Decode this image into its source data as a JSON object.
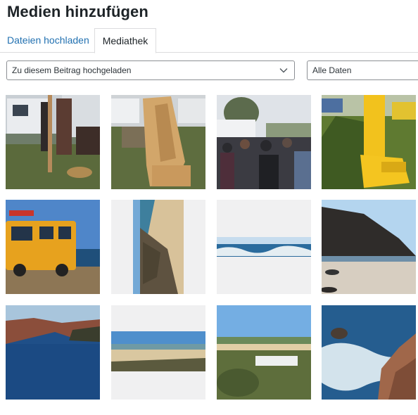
{
  "header": {
    "title": "Medien hinzufügen"
  },
  "tabs": [
    {
      "label": "Dateien hochladen"
    },
    {
      "label": "Mediathek"
    }
  ],
  "filters": {
    "attachment_filter": "Zu diesem Beitrag hochgeladen",
    "date_filter": "Alle Daten"
  },
  "colors": {
    "link": "#2271b1",
    "border": "#dcdcde"
  },
  "media": [
    {
      "type": "image",
      "subject": "camper-vans-people"
    },
    {
      "type": "image",
      "subject": "wooden-sculpture"
    },
    {
      "type": "image",
      "subject": "market-crowd"
    },
    {
      "type": "image",
      "subject": "yellow-excavator"
    },
    {
      "type": "image",
      "subject": "yellow-van-coast"
    },
    {
      "type": "image",
      "subject": "beach-cliff-vertical"
    },
    {
      "type": "image",
      "subject": "ocean-panorama"
    },
    {
      "type": "image",
      "subject": "beach-cliffs"
    },
    {
      "type": "image",
      "subject": "sea-cliffs"
    },
    {
      "type": "image",
      "subject": "sandy-beach-panorama"
    },
    {
      "type": "image",
      "subject": "bay-with-dunes"
    },
    {
      "type": "image",
      "subject": "rocky-shore-waves"
    }
  ]
}
